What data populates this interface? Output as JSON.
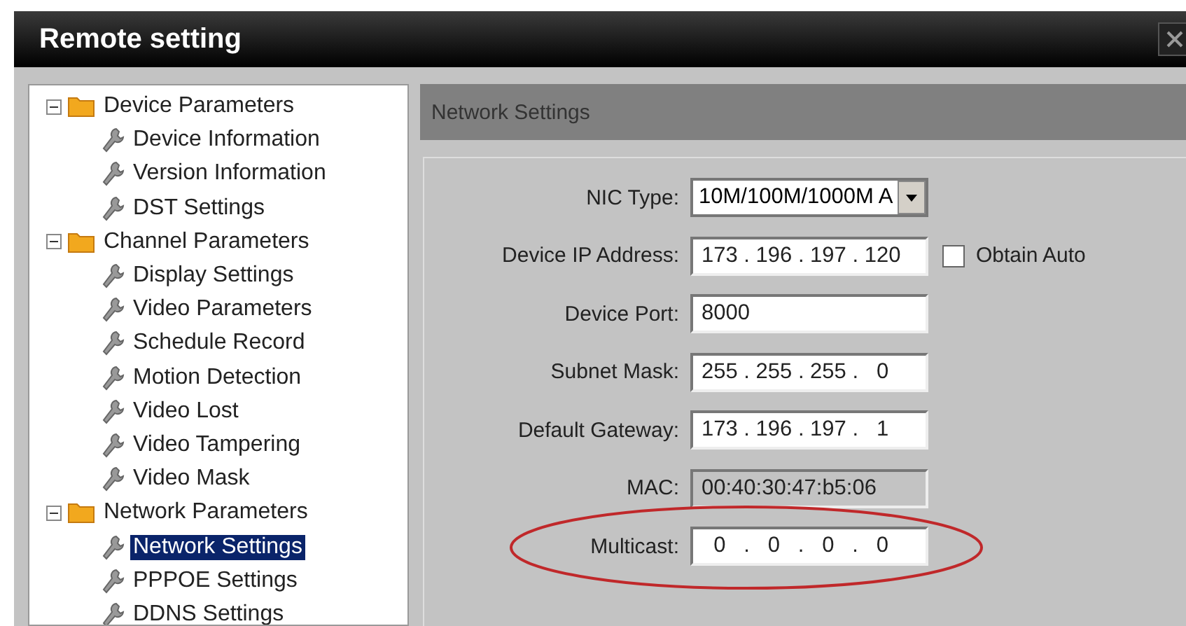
{
  "window": {
    "title": "Remote setting"
  },
  "tree": [
    {
      "label": "Device Parameters",
      "expanded": true,
      "children": [
        {
          "label": "Device Information",
          "selected": false
        },
        {
          "label": "Version Information",
          "selected": false
        },
        {
          "label": "DST Settings",
          "selected": false
        }
      ]
    },
    {
      "label": "Channel Parameters",
      "expanded": true,
      "children": [
        {
          "label": "Display Settings",
          "selected": false
        },
        {
          "label": "Video Parameters",
          "selected": false
        },
        {
          "label": "Schedule Record",
          "selected": false
        },
        {
          "label": "Motion Detection",
          "selected": false
        },
        {
          "label": "Video Lost",
          "selected": false
        },
        {
          "label": "Video Tampering",
          "selected": false
        },
        {
          "label": "Video Mask",
          "selected": false
        }
      ]
    },
    {
      "label": "Network Parameters",
      "expanded": true,
      "children": [
        {
          "label": "Network Settings",
          "selected": true
        },
        {
          "label": "PPPOE Settings",
          "selected": false
        },
        {
          "label": "DDNS Settings",
          "selected": false
        }
      ]
    }
  ],
  "panel": {
    "title": "Network Settings",
    "fields": [
      {
        "kind": "select",
        "label": "NIC Type:",
        "value": "10M/100M/1000M A"
      },
      {
        "kind": "ip",
        "label": "Device IP Address:",
        "value": "173 . 196 . 197 . 120",
        "checkbox": {
          "label": "Obtain Auto",
          "checked": false
        }
      },
      {
        "kind": "text",
        "label": "Device Port:",
        "value": "8000"
      },
      {
        "kind": "ip",
        "label": "Subnet Mask:",
        "value": "255 . 255 . 255 .   0"
      },
      {
        "kind": "ip",
        "label": "Default Gateway:",
        "value": "173 . 196 . 197 .   1"
      },
      {
        "kind": "readonly",
        "label": "MAC:",
        "value": "00:40:30:47:b5:06"
      },
      {
        "kind": "ip",
        "label": "Multicast:",
        "value": "  0   .   0   .   0   .   0",
        "circled": true
      }
    ]
  }
}
